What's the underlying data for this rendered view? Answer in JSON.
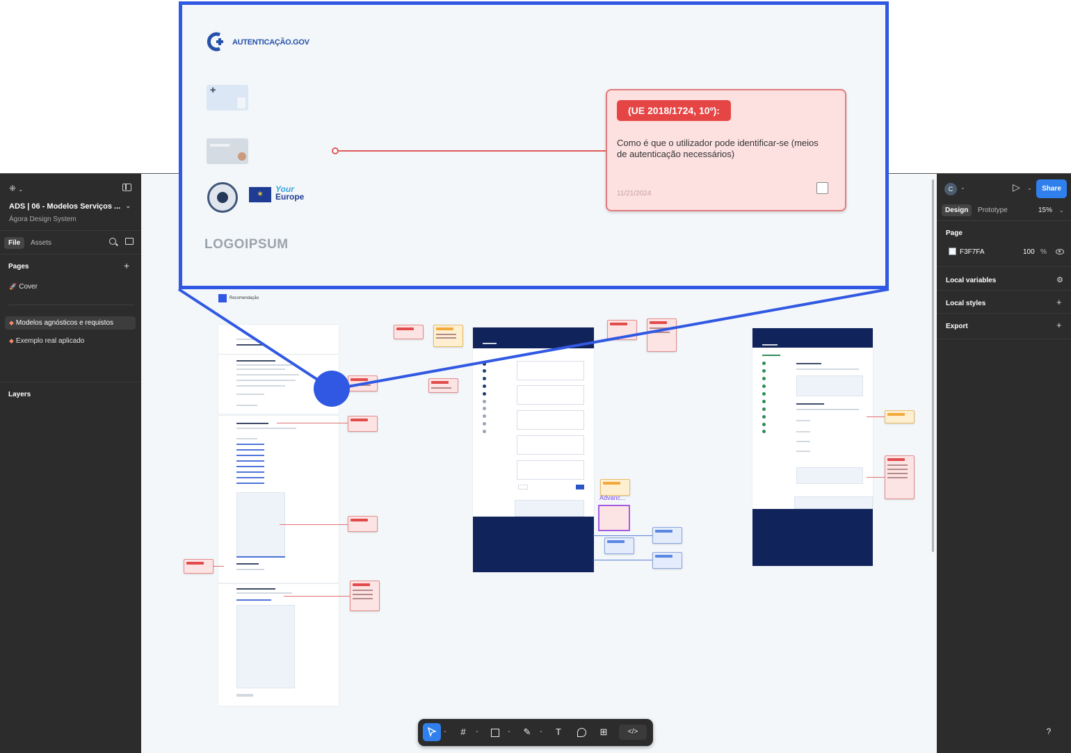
{
  "file": {
    "title": "ADS | 06 - Modelos Serviços ...",
    "team": "Ágora Design System"
  },
  "left_panel": {
    "tabs": [
      "File",
      "Assets"
    ],
    "pages_heading": "Pages",
    "pages": [
      {
        "label": "Cover",
        "icon": "rocket-icon"
      },
      {
        "label": "Modelos agnósticos e requistos",
        "icon": "diamond-icon",
        "selected": true
      },
      {
        "label": "Exemplo real aplicado",
        "icon": "diamond-icon"
      }
    ],
    "layers_heading": "Layers"
  },
  "right_panel": {
    "avatar": "C",
    "share_label": "Share",
    "tabs": [
      "Design",
      "Prototype"
    ],
    "zoom": "15%",
    "page_section": "Page",
    "page_color_hex": "F3F7FA",
    "page_opacity": "100",
    "opacity_unit": "%",
    "local_variables": "Local variables",
    "local_styles": "Local styles",
    "export": "Export"
  },
  "zoom_preview": {
    "auth_label": "AUTENTICAÇÃO.GOV",
    "your_europe_1": "Your",
    "your_europe_2": "Europe",
    "logoipsum": "LOGOIPSUM",
    "note_tag": "(UE 2018/1724, 10º):",
    "note_body": "Como é que o utilizador pode identificar-se (meios de autenticação necessários)",
    "note_date": "11/21/2024"
  },
  "canvas": {
    "legend_label": "Recomendação",
    "advanc_label": "Advanc..."
  },
  "toolbar": {
    "tools": [
      "move",
      "frame",
      "rectangle",
      "pen",
      "text",
      "comment",
      "actions"
    ],
    "dev_label": "</>"
  },
  "help_label": "?",
  "colors": {
    "accent": "#2f80ed",
    "highlight": "#3158e2",
    "note_red": "#e64545",
    "canvas_bg": "#f3f7fa",
    "panel_bg": "#2c2c2c"
  }
}
